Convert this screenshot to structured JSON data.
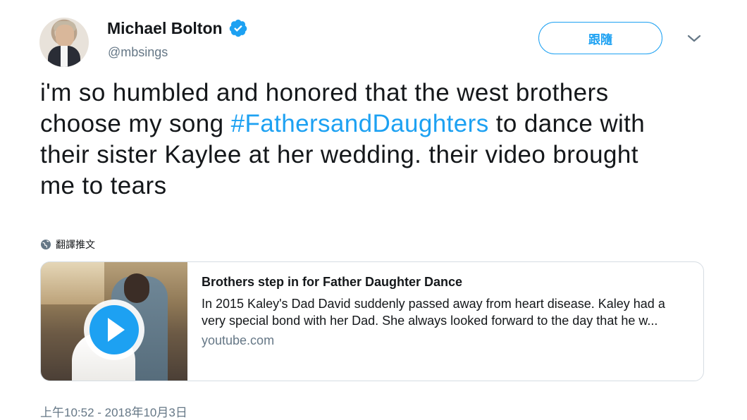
{
  "profile": {
    "display_name": "Michael Bolton",
    "handle": "@mbsings",
    "verified": true
  },
  "actions": {
    "follow_label": "跟隨",
    "menu_icon": "chevron-down-icon"
  },
  "tweet": {
    "text_part1": "i'm so humbled and honored that the west brothers choose my song ",
    "hashtag": "#FathersandDaughters",
    "text_part2": " to dance with their sister Kaylee at her wedding. their video brought me to tears",
    "translate_label": "翻譯推文",
    "timestamp": "上午10:52 - 2018年10月3日"
  },
  "card": {
    "title": "Brothers step in for Father Daughter Dance",
    "description": "In 2015 Kaley's Dad David suddenly passed away from heart disease. Kaley had a very special bond with her Dad. She always looked forward to the day that he w...",
    "domain": "youtube.com",
    "thumbnail_icon": "play-icon"
  },
  "colors": {
    "accent": "#1da1f2",
    "secondary_text": "#657786",
    "primary_text": "#14171a",
    "border": "#d6dde3"
  }
}
